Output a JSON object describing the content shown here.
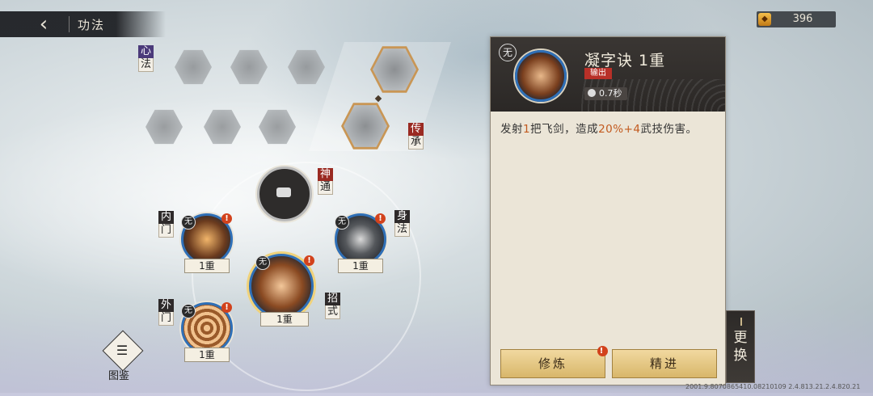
{
  "header": {
    "title": "功法",
    "back_icon": "back-arrow-icon"
  },
  "currency": {
    "amount": "396",
    "icon": "coin-icon"
  },
  "categories": {
    "xinfa": [
      "心",
      "法"
    ],
    "chuancheng": [
      "传",
      "承"
    ],
    "shentong": [
      "神",
      "通"
    ],
    "neimen": [
      "内",
      "门"
    ],
    "shenfa": [
      "身",
      "法"
    ],
    "waimen": [
      "外",
      "门"
    ],
    "zhaoshi": [
      "招",
      "式"
    ]
  },
  "skills": {
    "neimen": {
      "element": "无",
      "level": "1重",
      "alert": "!"
    },
    "shenfa": {
      "element": "无",
      "level": "1重",
      "alert": "!"
    },
    "zhaoshi": {
      "element": "无",
      "level": "1重",
      "alert": "!"
    },
    "waimen": {
      "element": "无",
      "level": "1重",
      "alert": "!"
    }
  },
  "detail": {
    "element": "无",
    "name": "凝字诀  1重",
    "tag": "输出",
    "cooldown": "0.7秒",
    "description": {
      "p1": "发射",
      "n1": "1",
      "p2": "把飞剑，造成",
      "n2": "20%+4",
      "p3": "武技伤害。"
    },
    "buttons": {
      "cultivate": "修炼",
      "refine": "精进",
      "alert": "!"
    }
  },
  "swap": {
    "c1": "更",
    "c2": "换"
  },
  "codex": {
    "label": "图鉴"
  },
  "footer": "2001.9.8070865410.08210109 2.4.813.21.2.4.820.21",
  "colors": {
    "accent": "#c25a1f",
    "orb_border": "#2f6fb6",
    "button": "#e3c27e",
    "tag": "#b83028"
  }
}
